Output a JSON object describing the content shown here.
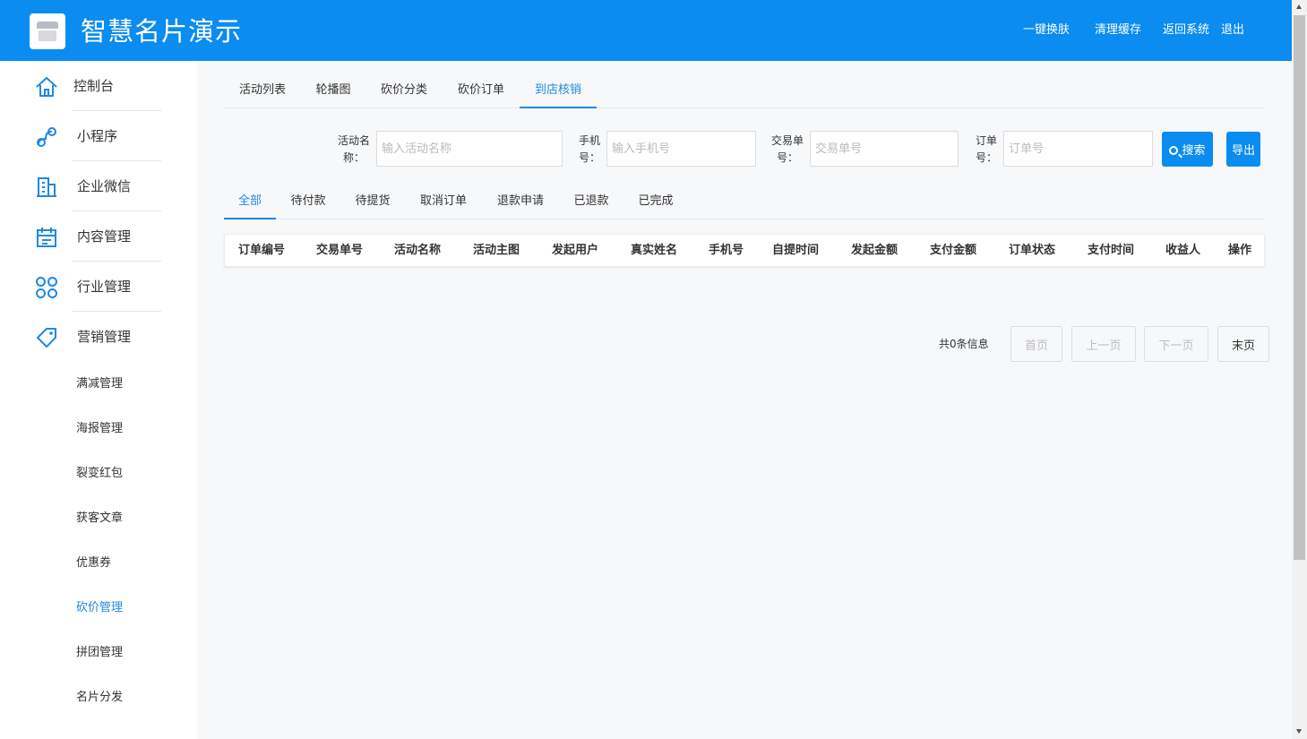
{
  "header": {
    "title": "智慧名片演示",
    "links": [
      "一键换肤",
      "清理缓存",
      "返回系统",
      "退出"
    ]
  },
  "sidebar": {
    "items": [
      {
        "label": "控制台",
        "icon": "home-icon"
      },
      {
        "label": "小程序",
        "icon": "link-icon"
      },
      {
        "label": "企业微信",
        "icon": "building-icon"
      },
      {
        "label": "内容管理",
        "icon": "calendar-icon"
      },
      {
        "label": "行业管理",
        "icon": "grid-icon"
      },
      {
        "label": "营销管理",
        "icon": "tag-icon"
      }
    ],
    "subitems": [
      "满减管理",
      "海报管理",
      "裂变红包",
      "获客文章",
      "优惠券",
      "砍价管理",
      "拼团管理",
      "名片分发"
    ],
    "active_sub": "砍价管理"
  },
  "top_tabs": [
    "活动列表",
    "轮播图",
    "砍价分类",
    "砍价订单",
    "到店核销"
  ],
  "top_tab_active": "到店核销",
  "filters": {
    "activity": {
      "label": "活动名称：",
      "placeholder": "输入活动名称"
    },
    "phone": {
      "label": "手机号：",
      "placeholder": "输入手机号"
    },
    "trade": {
      "label": "交易单号：",
      "placeholder": "交易单号"
    },
    "order": {
      "label": "订单号：",
      "placeholder": "订单号"
    },
    "search_label": "搜索",
    "export_label": "导出"
  },
  "status_tabs": [
    "全部",
    "待付款",
    "待提货",
    "取消订单",
    "退款申请",
    "已退款",
    "已完成"
  ],
  "status_tab_active": "全部",
  "table": {
    "columns": [
      "订单编号",
      "交易单号",
      "活动名称",
      "活动主图",
      "发起用户",
      "真实姓名",
      "手机号",
      "自提时间",
      "发起金额",
      "支付金额",
      "订单状态",
      "支付时间",
      "收益人",
      "操作"
    ],
    "rows": []
  },
  "pager": {
    "info": "共0条信息",
    "first": "首页",
    "prev": "上一页",
    "next": "下一页",
    "last": "末页"
  },
  "colors": {
    "primary": "#0a8cf0",
    "accent_text": "#1e88e5"
  }
}
